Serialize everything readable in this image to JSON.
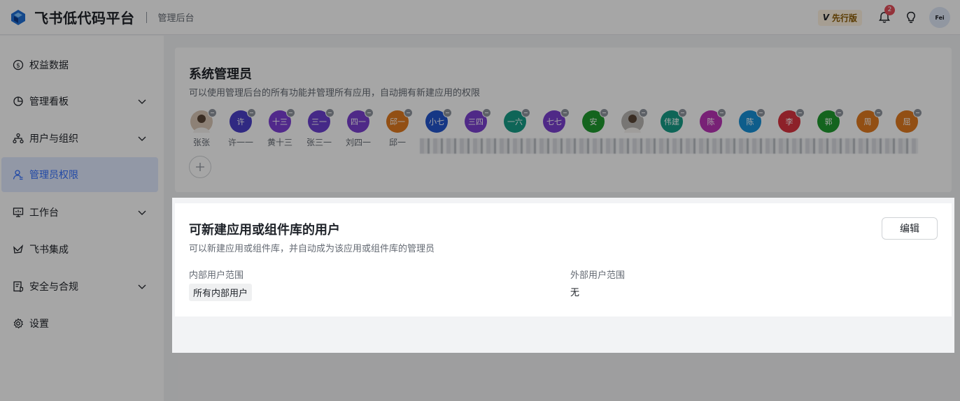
{
  "header": {
    "brand": "飞书低代码平台",
    "subtitle": "管理后台",
    "edition": "先行版",
    "notification_count": "2",
    "user_avatar_text": "Fei"
  },
  "sidebar": {
    "items": [
      {
        "label": "权益数据",
        "icon": "dollar-circle-icon",
        "expandable": false,
        "active": false
      },
      {
        "label": "管理看板",
        "icon": "pie-chart-icon",
        "expandable": true,
        "active": false
      },
      {
        "label": "用户与组织",
        "icon": "org-tree-icon",
        "expandable": true,
        "active": false
      },
      {
        "label": "管理员权限",
        "icon": "admin-user-icon",
        "expandable": false,
        "active": true
      },
      {
        "label": "工作台",
        "icon": "monitor-icon",
        "expandable": true,
        "active": false
      },
      {
        "label": "飞书集成",
        "icon": "feishu-icon",
        "expandable": false,
        "active": false
      },
      {
        "label": "安全与合规",
        "icon": "shield-doc-icon",
        "expandable": true,
        "active": false
      },
      {
        "label": "设置",
        "icon": "gear-icon",
        "expandable": false,
        "active": false
      }
    ]
  },
  "system_admin": {
    "title": "系统管理员",
    "description": "可以使用管理后台的所有功能并管理所有应用，自动拥有新建应用的权限",
    "members": [
      {
        "avatar": "",
        "name": "张张",
        "color": "#d9c7b5",
        "photo": true
      },
      {
        "avatar": "许",
        "name": "许一一",
        "color": "#4a3fc8"
      },
      {
        "avatar": "十三",
        "name": "黄十三",
        "color": "#7d3fd6"
      },
      {
        "avatar": "三一",
        "name": "张三一",
        "color": "#6a3fd0"
      },
      {
        "avatar": "四一",
        "name": "刘四一",
        "color": "#7a3fd0"
      },
      {
        "avatar": "邱一",
        "name": "邱一",
        "color": "#e07a1f"
      },
      {
        "avatar": "小七",
        "name": "",
        "color": "#2255cc"
      },
      {
        "avatar": "三四",
        "name": "",
        "color": "#7a3fd0"
      },
      {
        "avatar": "一六",
        "name": "",
        "color": "#169b86"
      },
      {
        "avatar": "七七",
        "name": "",
        "color": "#7a3fd0"
      },
      {
        "avatar": "安",
        "name": "",
        "color": "#1f9a2e"
      },
      {
        "avatar": "",
        "name": "",
        "color": "#b9b6b2",
        "photo": true
      },
      {
        "avatar": "伟建",
        "name": "",
        "color": "#169b86"
      },
      {
        "avatar": "陈",
        "name": "",
        "color": "#b934b5"
      },
      {
        "avatar": "陈",
        "name": "",
        "color": "#168fd6"
      },
      {
        "avatar": "李",
        "name": "",
        "color": "#d9333f"
      },
      {
        "avatar": "郭",
        "name": "",
        "color": "#1f9a2e"
      },
      {
        "avatar": "周",
        "name": "",
        "color": "#e07a1f"
      },
      {
        "avatar": "屈",
        "name": "",
        "color": "#e07a1f"
      }
    ]
  },
  "creator_users": {
    "title": "可新建应用或组件库的用户",
    "description": "可以新建应用或组件库，并自动成为该应用或组件库的管理员",
    "edit_label": "编辑",
    "internal_label": "内部用户范围",
    "internal_value": "所有内部用户",
    "external_label": "外部用户范围",
    "external_value": "无"
  }
}
